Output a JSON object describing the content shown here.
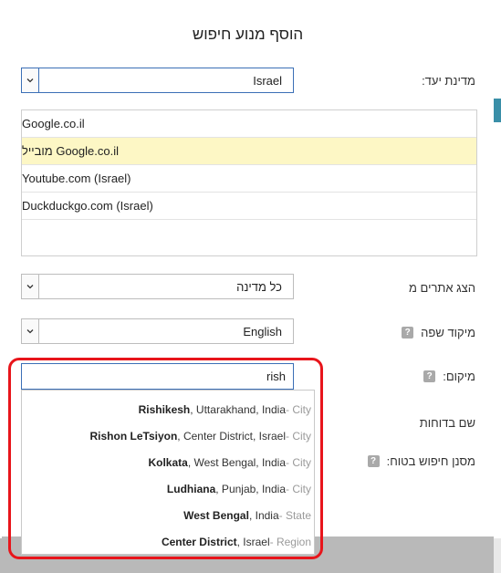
{
  "modal": {
    "title": "הוסף מנוע חיפוש"
  },
  "country": {
    "label": "מדינת יעד:",
    "value": "Israel"
  },
  "engines": {
    "items": [
      {
        "label": "Google.co.il",
        "selected": false
      },
      {
        "label": "Google.co.il מובייל",
        "selected": true
      },
      {
        "label": "(Israel) Youtube.com",
        "selected": false
      },
      {
        "label": "(Israel) Duckduckgo.com",
        "selected": false
      }
    ]
  },
  "show_sites": {
    "label": "הצג אתרים מ",
    "value": "כל מדינה"
  },
  "language": {
    "label": "מיקוד שפה",
    "value": "English",
    "help": "?"
  },
  "location": {
    "label": "מיקום:",
    "help": "?",
    "value": "rish",
    "suggestions": [
      {
        "name": "Rishikesh",
        "rest": ", Uttarakhand, India",
        "type": " - City"
      },
      {
        "name": "Rishon LeTsiyon",
        "rest": ", Center District, Israel",
        "type": " - City"
      },
      {
        "name": "Kolkata",
        "rest": ", West Bengal, India",
        "type": " - City"
      },
      {
        "name": "Ludhiana",
        "rest": ", Punjab, India",
        "type": " - City"
      },
      {
        "name": "West Bengal",
        "rest": ", India",
        "type": " - State"
      },
      {
        "name": "Center District",
        "rest": ", Israel",
        "type": " - Region"
      }
    ]
  },
  "report_name": {
    "label": "שם בדוחות"
  },
  "safe_search": {
    "label": "מסנן חיפוש בטוח:",
    "help": "?"
  },
  "colors": {
    "highlight": "#e8151b",
    "selected_row": "#fdf7c5",
    "focus_border": "#3b6fb6"
  }
}
